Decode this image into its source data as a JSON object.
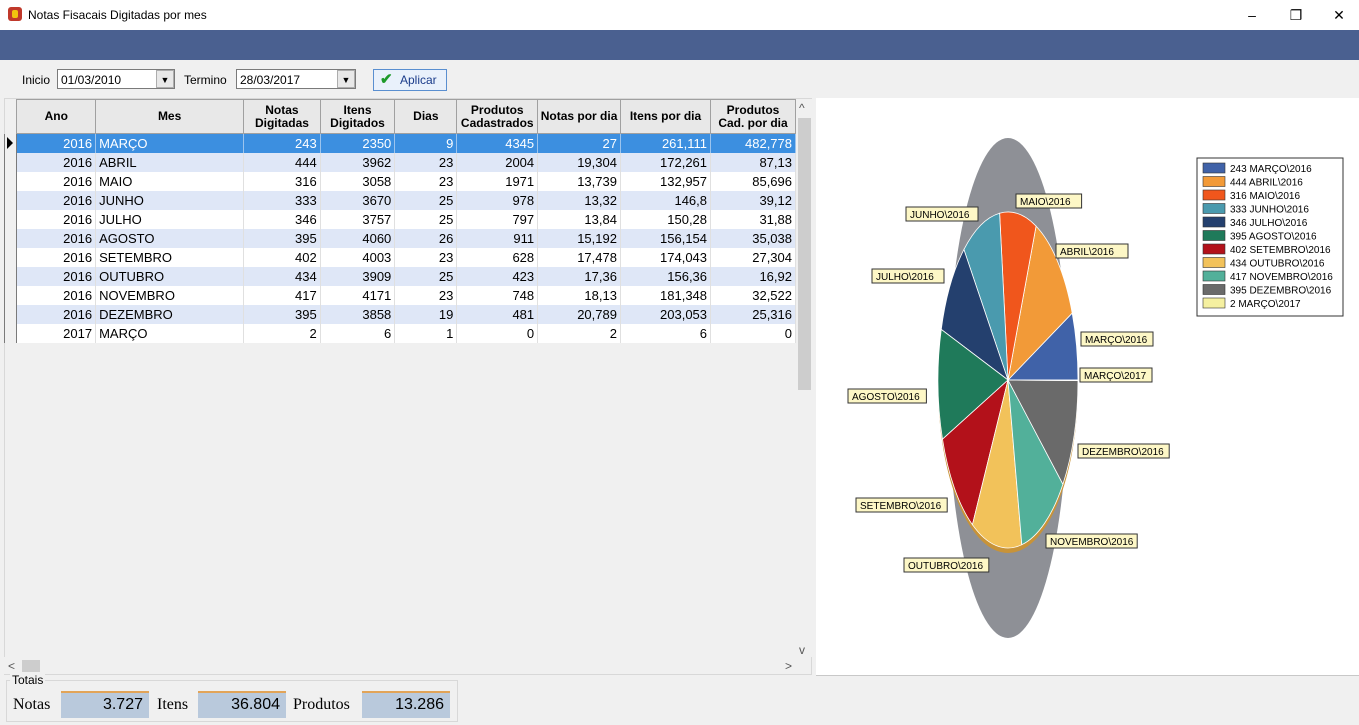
{
  "window": {
    "title": "Notas Fisacais Digitadas por mes",
    "minimize": "–",
    "maximize": "❐",
    "close": "✕"
  },
  "filters": {
    "inicio_label": "Inicio",
    "inicio_value": "01/03/2010",
    "termino_label": "Termino",
    "termino_value": "28/03/2017",
    "apply_label": "Aplicar"
  },
  "grid": {
    "columns": [
      "Ano",
      "Mes",
      "Notas Digitadas",
      "Itens Digitados",
      "Dias",
      "Produtos Cadastrados",
      "Notas por dia",
      "Itens por dia",
      "Produtos Cad. por dia"
    ],
    "rows": [
      [
        "2016",
        "MARÇO",
        "243",
        "2350",
        "9",
        "4345",
        "27",
        "261,111",
        "482,778"
      ],
      [
        "2016",
        "ABRIL",
        "444",
        "3962",
        "23",
        "2004",
        "19,304",
        "172,261",
        "87,13"
      ],
      [
        "2016",
        "MAIO",
        "316",
        "3058",
        "23",
        "1971",
        "13,739",
        "132,957",
        "85,696"
      ],
      [
        "2016",
        "JUNHO",
        "333",
        "3670",
        "25",
        "978",
        "13,32",
        "146,8",
        "39,12"
      ],
      [
        "2016",
        "JULHO",
        "346",
        "3757",
        "25",
        "797",
        "13,84",
        "150,28",
        "31,88"
      ],
      [
        "2016",
        "AGOSTO",
        "395",
        "4060",
        "26",
        "911",
        "15,192",
        "156,154",
        "35,038"
      ],
      [
        "2016",
        "SETEMBRO",
        "402",
        "4003",
        "23",
        "628",
        "17,478",
        "174,043",
        "27,304"
      ],
      [
        "2016",
        "OUTUBRO",
        "434",
        "3909",
        "25",
        "423",
        "17,36",
        "156,36",
        "16,92"
      ],
      [
        "2016",
        "NOVEMBRO",
        "417",
        "4171",
        "23",
        "748",
        "18,13",
        "181,348",
        "32,522"
      ],
      [
        "2016",
        "DEZEMBRO",
        "395",
        "3858",
        "19",
        "481",
        "20,789",
        "203,053",
        "25,316"
      ],
      [
        "2017",
        "MARÇO",
        "2",
        "6",
        "1",
        "0",
        "2",
        "6",
        "0"
      ]
    ]
  },
  "totals": {
    "title": "Totais",
    "notas_label": "Notas",
    "notas_value": "3.727",
    "itens_label": "Itens",
    "itens_value": "36.804",
    "produtos_label": "Produtos",
    "produtos_value": "13.286"
  },
  "chart_data": {
    "type": "pie",
    "categories": [
      "MARÇO\\2016",
      "ABRIL\\2016",
      "MAIO\\2016",
      "JUNHO\\2016",
      "JULHO\\2016",
      "AGOSTO\\2016",
      "SETEMBRO\\2016",
      "OUTUBRO\\2016",
      "NOVEMBRO\\2016",
      "DEZEMBRO\\2016",
      "MARÇO\\2017"
    ],
    "values": [
      243,
      444,
      316,
      333,
      346,
      395,
      402,
      434,
      417,
      395,
      2
    ],
    "legend": [
      "243 MARÇO\\2016",
      "444 ABRIL\\2016",
      "316 MAIO\\2016",
      "333 JUNHO\\2016",
      "346 JULHO\\2016",
      "395 AGOSTO\\2016",
      "402 SETEMBRO\\2016",
      "434 OUTUBRO\\2016",
      "417 NOVEMBRO\\2016",
      "395 DEZEMBRO\\2016",
      "2 MARÇO\\2017"
    ],
    "colors": [
      "#4062a8",
      "#f29a38",
      "#f0561c",
      "#4a9aae",
      "#24406e",
      "#1f7a5a",
      "#b3111a",
      "#f2c25a",
      "#52b09a",
      "#6a6a6a",
      "#f5f0a0"
    ],
    "legend_position": "top-right"
  }
}
